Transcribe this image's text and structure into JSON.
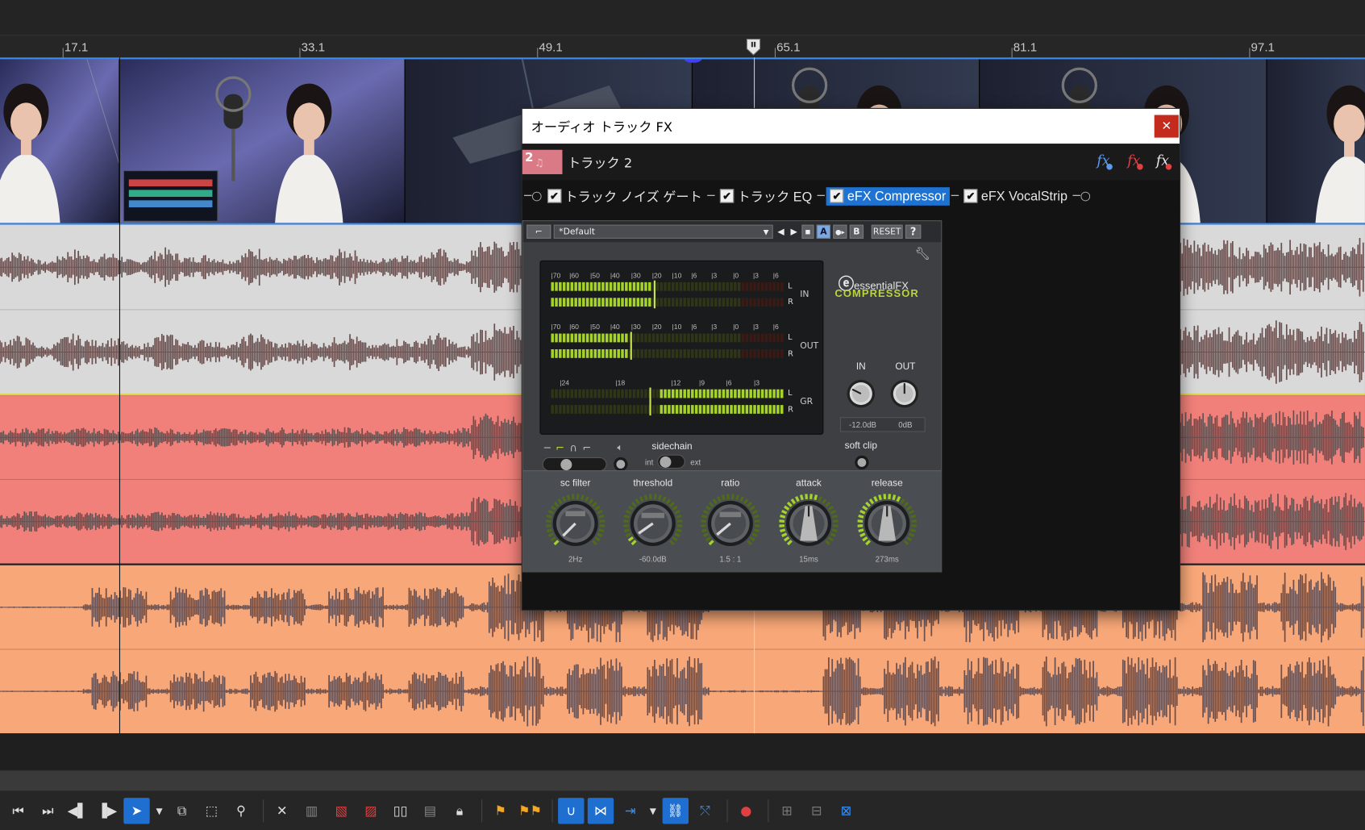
{
  "ruler": {
    "ticks": [
      "17.1",
      "33.1",
      "49.1",
      "65.1",
      "81.1",
      "97.1"
    ]
  },
  "colors": {
    "track1_bg": "#d9d9d9",
    "track2_bg": "#f2807a",
    "track3_bg": "#f8a878",
    "waveform": "#6b5050",
    "accent_blue": "#1e73d2",
    "meter_green": "#a6d22c"
  },
  "fx_dialog": {
    "title": "オーディオ トラック FX",
    "close_icon": "close-icon",
    "track_number": "2",
    "track_name": "トラック 2",
    "chain": [
      {
        "label": "トラック ノイズ ゲート",
        "checked": true
      },
      {
        "label": "トラック EQ",
        "checked": true
      },
      {
        "label": "eFX Compressor",
        "checked": true,
        "selected": true
      },
      {
        "label": "eFX VocalStrip",
        "checked": true
      }
    ]
  },
  "plugin": {
    "preset": "*Default",
    "ab_a": "A",
    "ab_b": "B",
    "reset": "RESET",
    "help": "?",
    "brand_line1": "essentialFX",
    "brand_line2": "COMPRESSOR",
    "meters": {
      "scale_top": [
        "70",
        "60",
        "50",
        "40",
        "30",
        "20",
        "10",
        "6",
        "3",
        "0",
        "3",
        "6"
      ],
      "scale_gr": [
        "24",
        "18",
        "12",
        "9",
        "6",
        "3"
      ],
      "in": "IN",
      "out": "OUT",
      "gr": "GR",
      "l": "L",
      "r": "R"
    },
    "gain": {
      "in_label": "IN",
      "out_label": "OUT",
      "in_value": "-12.0dB",
      "out_value": "0dB"
    },
    "sidechain": {
      "label": "sidechain",
      "int": "int",
      "ext": "ext"
    },
    "soft_clip": "soft clip",
    "knobs": [
      {
        "label": "sc filter",
        "value": "2Hz"
      },
      {
        "label": "threshold",
        "value": "-60.0dB"
      },
      {
        "label": "ratio",
        "value": "1.5 : 1"
      },
      {
        "label": "attack",
        "value": "15ms"
      },
      {
        "label": "release",
        "value": "273ms"
      }
    ]
  },
  "toolbar": {
    "icons": [
      "skip-start-icon",
      "skip-end-icon",
      "prev-frame-icon",
      "next-frame-icon",
      "pointer-icon",
      "dropdown-icon",
      "group-icon",
      "select-rect-icon",
      "zoom-icon",
      "delete-icon",
      "split-icon",
      "trim-start-icon",
      "trim-end-icon",
      "split-all-icon",
      "ripple-icon",
      "lock-icon",
      "marker-icon",
      "region-icon",
      "snap-icon",
      "auto-ripple-icon",
      "insert-icon",
      "dropdown-icon",
      "lock-envelope-icon",
      "auto-crossfade-icon",
      "color-icon",
      "group-add-icon",
      "group-remove-icon",
      "group-track-icon"
    ]
  }
}
